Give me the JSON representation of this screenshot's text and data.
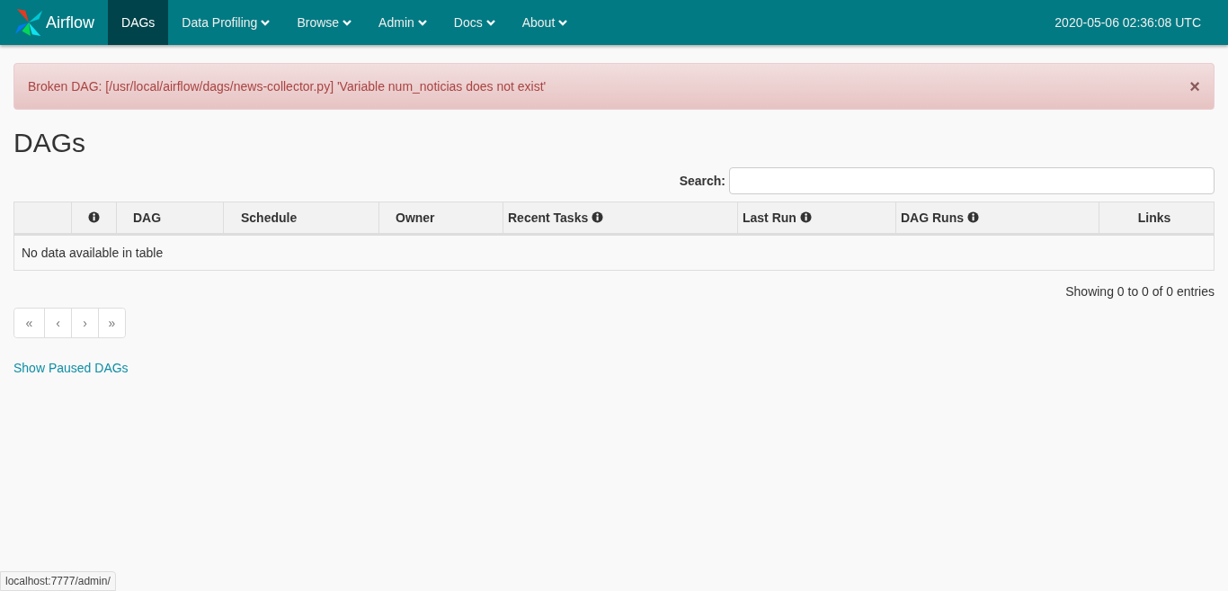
{
  "navbar": {
    "brand": "Airflow",
    "items": [
      {
        "label": "DAGs",
        "selected": true,
        "dropdown": false
      },
      {
        "label": "Data Profiling",
        "selected": false,
        "dropdown": true
      },
      {
        "label": "Browse",
        "selected": false,
        "dropdown": true
      },
      {
        "label": "Admin",
        "selected": false,
        "dropdown": true
      },
      {
        "label": "Docs",
        "selected": false,
        "dropdown": true
      },
      {
        "label": "About",
        "selected": false,
        "dropdown": true
      }
    ],
    "clock": "2020-05-06 02:36:08 UTC"
  },
  "alert": {
    "message": "Broken DAG: [/usr/local/airflow/dags/news-collector.py] 'Variable num_noticias does not exist'",
    "close": "×"
  },
  "page_title": "DAGs",
  "search": {
    "label": "Search:"
  },
  "table": {
    "columns": [
      {
        "info": false
      },
      {
        "info": true
      },
      {
        "label": "DAG",
        "info": false
      },
      {
        "label": "Schedule",
        "info": false
      },
      {
        "label": "Owner",
        "info": false
      },
      {
        "label": "Recent Tasks",
        "info": true
      },
      {
        "label": "Last Run",
        "info": true
      },
      {
        "label": "DAG Runs",
        "info": true
      },
      {
        "label": "Links",
        "info": false
      }
    ],
    "empty_message": "No data available in table"
  },
  "entries_info": "Showing 0 to 0 of 0 entries",
  "pagination": [
    "«",
    "‹",
    "›",
    "»"
  ],
  "paused_link": "Show Paused DAGs",
  "status_url": "localhost:7777/admin/"
}
